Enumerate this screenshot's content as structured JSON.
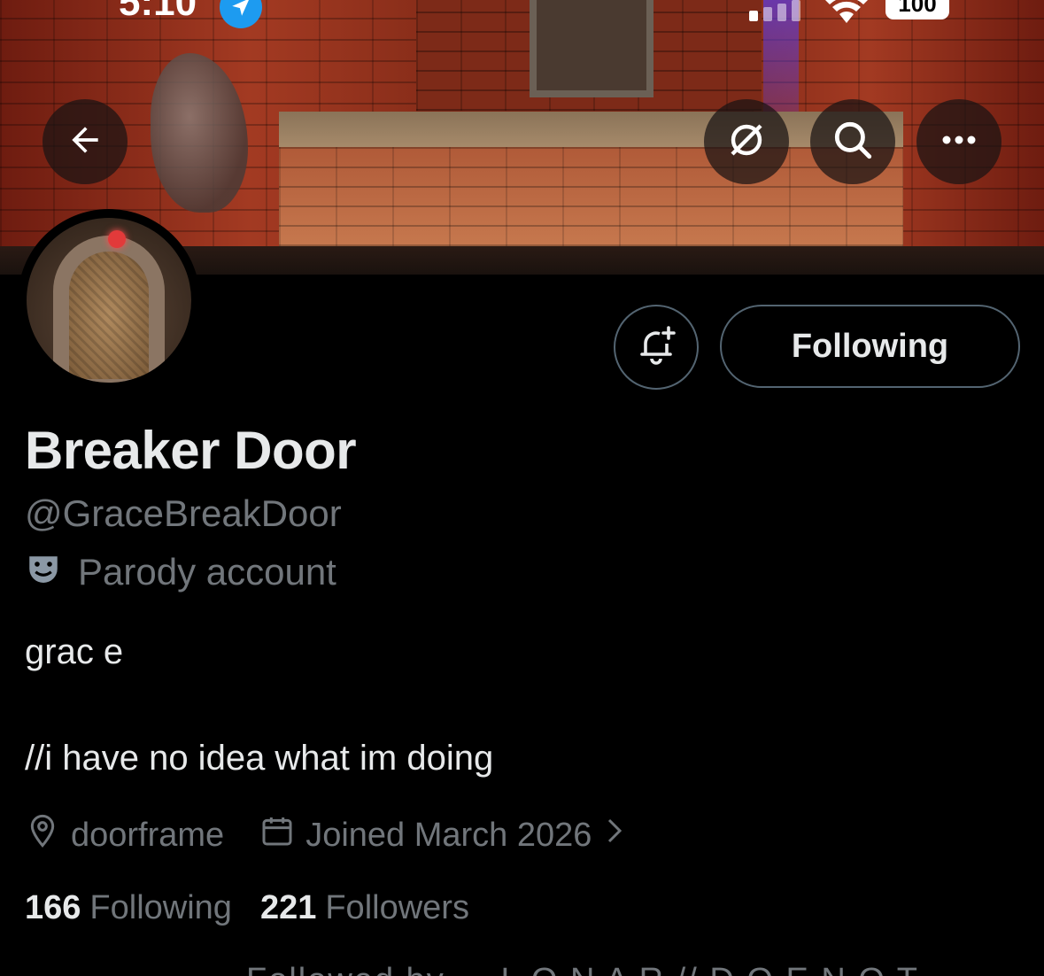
{
  "status_bar": {
    "time": "5:10",
    "battery": "100"
  },
  "banner_buttons": {
    "back_icon": "arrow-left-icon",
    "grok_icon": "slash-circle-icon",
    "search_icon": "search-icon",
    "more_icon": "more-horizontal-icon"
  },
  "profile": {
    "display_name": "Breaker Door",
    "handle": "@GraceBreakDoor",
    "parody_label": "Parody account",
    "bio_line1": "grac e",
    "bio_line2": "//i have no idea what im doing",
    "location": "doorframe",
    "joined": "Joined March 2026",
    "following_count": "166",
    "following_label": "Following",
    "followers_count": "221",
    "followers_label": "Followers",
    "followed_by_partial": "Followed by ... L O N A R // D O E N O T"
  },
  "actions": {
    "notify_icon": "bell-plus-icon",
    "following_button": "Following"
  },
  "colors": {
    "background": "#000000",
    "primary_text": "#e7e9ea",
    "secondary_text": "#71767b",
    "border": "#536471",
    "accent": "#1d9bf0"
  }
}
